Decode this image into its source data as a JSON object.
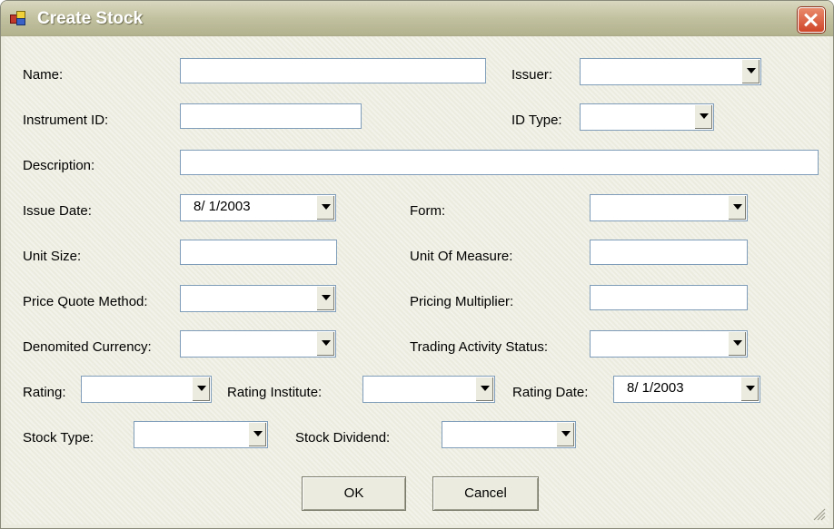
{
  "window": {
    "title": "Create Stock"
  },
  "labels": {
    "name": "Name:",
    "issuer": "Issuer:",
    "instrument_id": "Instrument  ID:",
    "id_type": "ID Type:",
    "description": "Description:",
    "issue_date": "Issue Date:",
    "form": "Form:",
    "unit_size": "Unit Size:",
    "unit_of_measure": "Unit Of Measure:",
    "price_quote_method": "Price Quote Method:",
    "pricing_multiplier": "Pricing Multiplier:",
    "denominated_currency": "Denomited Currency:",
    "trading_activity_status": "Trading Activity Status:",
    "rating": "Rating:",
    "rating_institute": "Rating Institute:",
    "rating_date": "Rating Date:",
    "stock_type": "Stock Type:",
    "stock_dividend": "Stock Dividend:"
  },
  "values": {
    "name": "",
    "issuer": "",
    "instrument_id": "",
    "id_type": "",
    "description": "",
    "issue_date": "8/  1/2003",
    "form": "",
    "unit_size": "",
    "unit_of_measure": "",
    "price_quote_method": "",
    "pricing_multiplier": "",
    "denominated_currency": "",
    "trading_activity_status": "",
    "rating": "",
    "rating_institute": "",
    "rating_date": "8/  1/2003",
    "stock_type": "",
    "stock_dividend": ""
  },
  "buttons": {
    "ok": "OK",
    "cancel": "Cancel"
  },
  "icons": {
    "app": "app-icon",
    "close": "close-icon",
    "dropdown": "chevron-down-icon",
    "resize": "resize-grip-icon"
  }
}
